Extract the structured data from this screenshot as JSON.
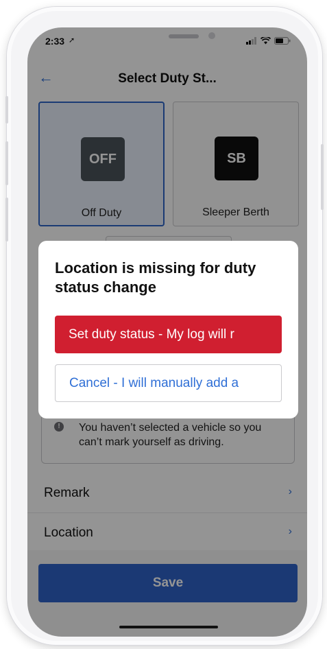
{
  "status_bar": {
    "time": "2:33"
  },
  "header": {
    "title": "Select Duty St..."
  },
  "duty_cards": [
    {
      "code": "OFF",
      "label": "Off Duty",
      "selected": true,
      "color": "#4b535b"
    },
    {
      "code": "SB",
      "label": "Sleeper Berth",
      "selected": false,
      "color": "#111111"
    }
  ],
  "info": {
    "text": "You haven’t selected a vehicle so you can’t mark yourself as driving."
  },
  "rows": [
    {
      "label": "Remark"
    },
    {
      "label": "Location"
    }
  ],
  "save": {
    "label": "Save"
  },
  "dialog": {
    "title": "Location is missing for duty status change",
    "primary_label": "Set duty status - My log will r",
    "secondary_label": "Cancel - I will manually add a"
  },
  "colors": {
    "accent": "#2f63c9",
    "danger": "#d01f30",
    "link": "#2f6fd6"
  }
}
